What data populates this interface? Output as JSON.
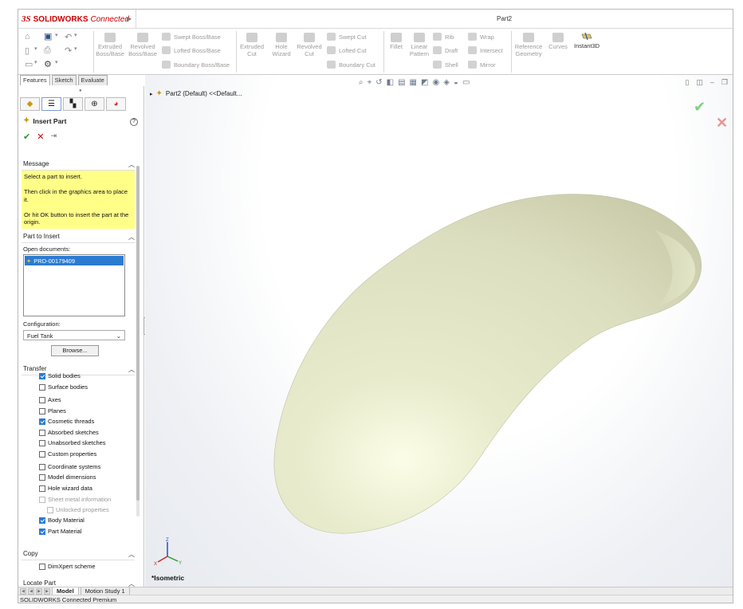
{
  "app": {
    "brand_prefix": "3S",
    "brand_name": "SOLIDWORKS",
    "brand_suffix": "Connected",
    "document_title": "Part2"
  },
  "toolbar": {
    "extruded_boss": "Extruded\nBoss/Base",
    "revolved_boss": "Revolved\nBoss/Base",
    "swept_boss": "Swept Boss/Base",
    "lofted_boss": "Lofted Boss/Base",
    "boundary_boss": "Boundary Boss/Base",
    "extruded_cut": "Extruded\nCut",
    "hole_wizard": "Hole\nWizard",
    "revolved_cut": "Revolved\nCut",
    "swept_cut": "Swept Cut",
    "lofted_cut": "Lofted Cut",
    "boundary_cut": "Boundary Cut",
    "fillet": "Fillet",
    "linear_pattern": "Linear\nPattern",
    "rib": "Rib",
    "wrap": "Wrap",
    "draft": "Draft",
    "intersect": "Intersect",
    "shell": "Shell",
    "mirror": "Mirror",
    "reference_geometry": "Reference\nGeometry",
    "curves": "Curves",
    "instant3d": "Instant3D"
  },
  "tabs": [
    "Features",
    "Sketch",
    "Evaluate"
  ],
  "property_manager": {
    "title": "Insert Part",
    "message_header": "Message",
    "message": "Select a part to insert.\n\nThen click in the graphics area to place it.\n\nOr hit OK button to insert the part at the origin.",
    "part_header": "Part to Insert",
    "open_docs_label": "Open documents:",
    "open_docs": [
      "PRD-00179409"
    ],
    "config_label": "Configuration:",
    "config_value": "Fuel Tank",
    "browse_label": "Browse...",
    "transfer_header": "Transfer",
    "transfer_items": [
      {
        "label": "Solid bodies",
        "checked": true,
        "enabled": true
      },
      {
        "label": "Surface bodies",
        "checked": false,
        "enabled": true
      },
      {
        "label": "Axes",
        "checked": false,
        "enabled": true
      },
      {
        "label": "Planes",
        "checked": false,
        "enabled": true
      },
      {
        "label": "Cosmetic threads",
        "checked": true,
        "enabled": true
      },
      {
        "label": "Absorbed sketches",
        "checked": false,
        "enabled": true
      },
      {
        "label": "Unabsorbed sketches",
        "checked": false,
        "enabled": true
      },
      {
        "label": "Custom properties",
        "checked": false,
        "enabled": true
      },
      {
        "label": "Coordinate systems",
        "checked": false,
        "enabled": true
      },
      {
        "label": "Model dimensions",
        "checked": false,
        "enabled": true
      },
      {
        "label": "Hole wizard data",
        "checked": false,
        "enabled": true
      },
      {
        "label": "Sheet metal information",
        "checked": false,
        "enabled": false
      },
      {
        "label": "Unlocked properties",
        "checked": false,
        "enabled": false
      },
      {
        "label": "Body Material",
        "checked": true,
        "enabled": true
      },
      {
        "label": "Part Material",
        "checked": true,
        "enabled": true
      }
    ],
    "copy_header": "Copy",
    "copy_items": [
      {
        "label": "DimXpert scheme",
        "checked": false
      }
    ],
    "locate_header": "Locate Part"
  },
  "graphics": {
    "tree_label": "Part2 (Default) <<Default...",
    "view_label": "*Isometric",
    "model_color": "#e6e7c9"
  },
  "bottom_tabs": [
    "Model",
    "Motion Study 1"
  ],
  "status_bar": "SOLIDWORKS Connected Premium",
  "colors": {
    "brand_red": "#cc0000",
    "selection_blue": "#2b7bd1",
    "message_yellow": "#ffff88",
    "ok_green": "#2a9a2a"
  }
}
